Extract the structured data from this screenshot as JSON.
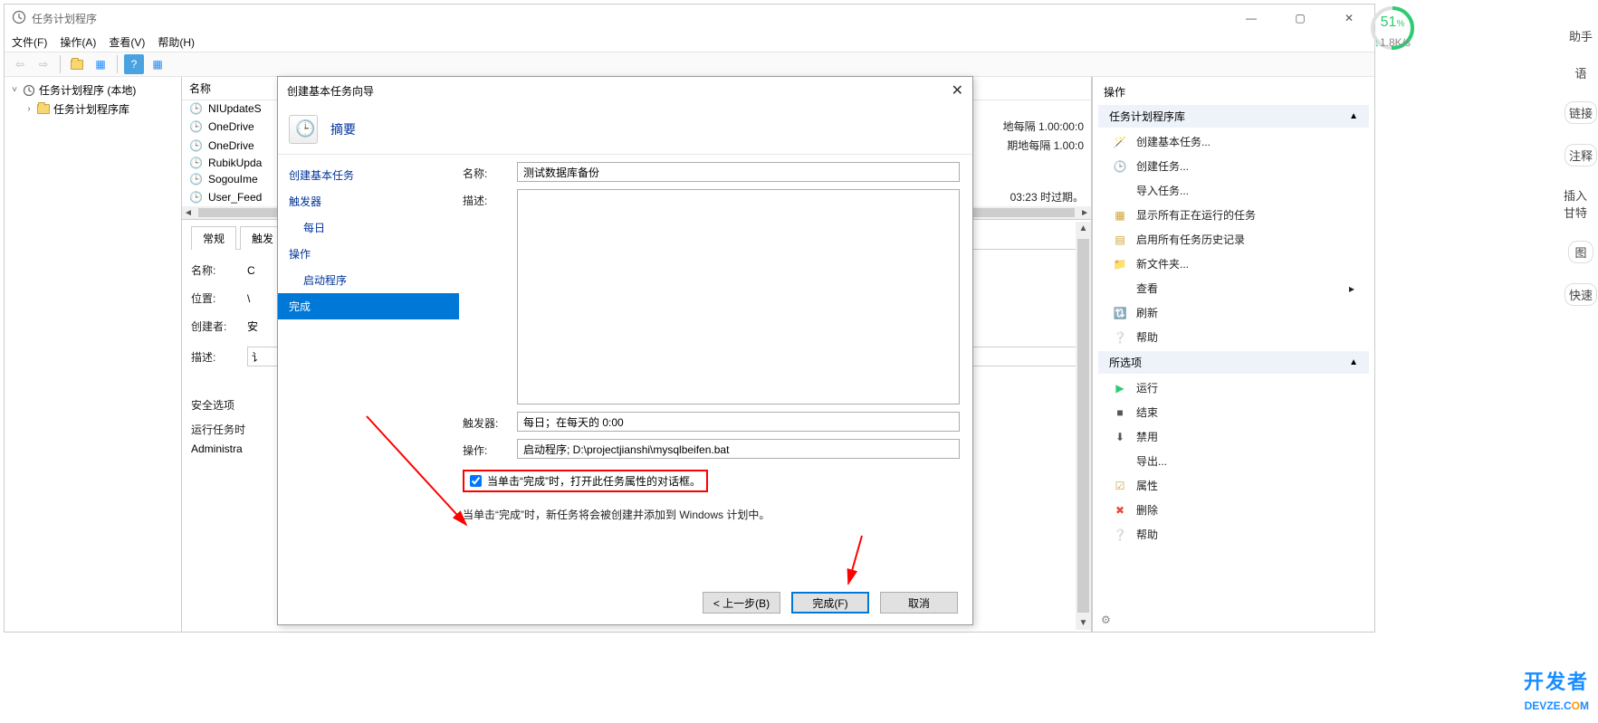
{
  "window": {
    "title": "任务计划程序",
    "menus": [
      "文件(F)",
      "操作(A)",
      "查看(V)",
      "帮助(H)"
    ]
  },
  "tree": {
    "root": "任务计划程序 (本地)",
    "child": "任务计划程序库"
  },
  "task_list": {
    "header": "名称",
    "rows": [
      {
        "name": "NIUpdateS",
        "trigger": ""
      },
      {
        "name": "OneDrive",
        "trigger": "地每隔 1.00:00:0"
      },
      {
        "name": "OneDrive",
        "trigger": "期地每隔 1.00:0"
      },
      {
        "name": "RubikUpda",
        "trigger": ""
      },
      {
        "name": "SogouIme",
        "trigger": ""
      },
      {
        "name": "User_Feed",
        "trigger": "03:23 时过期。"
      }
    ]
  },
  "detail": {
    "tabs": [
      "常规",
      "触发"
    ],
    "fields": {
      "name_label": "名称:",
      "name_val": "C",
      "location_label": "位置:",
      "location_val": "\\",
      "creator_label": "创建者:",
      "creator_val": "安",
      "desc_label": "描述:",
      "desc_val": "讠"
    },
    "security_title": "安全选项",
    "run_as_label": "运行任务时",
    "run_as_val": "Administra"
  },
  "actions_pane": {
    "title": "操作",
    "group1": {
      "title": "任务计划程序库",
      "items": [
        {
          "icon": "wizard",
          "label": "创建基本任务..."
        },
        {
          "icon": "clock",
          "label": "创建任务..."
        },
        {
          "icon": "import",
          "label": "导入任务..."
        },
        {
          "icon": "running",
          "label": "显示所有正在运行的任务"
        },
        {
          "icon": "history",
          "label": "启用所有任务历史记录"
        },
        {
          "icon": "folder",
          "label": "新文件夹..."
        },
        {
          "icon": "view",
          "label": "查看",
          "has_sub": true
        },
        {
          "icon": "refresh",
          "label": "刷新"
        },
        {
          "icon": "help",
          "label": "帮助"
        }
      ]
    },
    "group2": {
      "title": "所选项",
      "items": [
        {
          "icon": "play",
          "label": "运行"
        },
        {
          "icon": "stop",
          "label": "结束"
        },
        {
          "icon": "disable",
          "label": "禁用"
        },
        {
          "icon": "export",
          "label": "导出..."
        },
        {
          "icon": "props",
          "label": "属性"
        },
        {
          "icon": "delete",
          "label": "删除"
        },
        {
          "icon": "help",
          "label": "帮助"
        }
      ]
    }
  },
  "dialog": {
    "title": "创建基本任务向导",
    "banner": "摘要",
    "nav": [
      {
        "label": "创建基本任务",
        "sub": false
      },
      {
        "label": "触发器",
        "sub": false
      },
      {
        "label": "每日",
        "sub": true
      },
      {
        "label": "操作",
        "sub": false
      },
      {
        "label": "启动程序",
        "sub": true
      },
      {
        "label": "完成",
        "sub": false,
        "active": true
      }
    ],
    "fields": {
      "name_label": "名称:",
      "name_value": "测试数据库备份",
      "desc_label": "描述:",
      "desc_value": "",
      "trigger_label": "触发器:",
      "trigger_value": "每日；在每天的 0:00",
      "action_label": "操作:",
      "action_value": "启动程序; D:\\projectjianshi\\mysqlbeifen.bat"
    },
    "checkbox_label": "当单击“完成”时，打开此任务属性的对话框。",
    "info_text": "当单击“完成”时，新任务将会被创建并添加到 Windows 计划中。",
    "buttons": {
      "back": "< 上一步(B)",
      "finish": "完成(F)",
      "cancel": "取消"
    }
  },
  "perf": {
    "percent": "51",
    "unit": "%",
    "speed": "1.8K/s"
  },
  "far_right": [
    "助手",
    "语",
    "链接",
    "注释",
    "插入甘特",
    "图",
    "快速"
  ],
  "logo": {
    "zh": "开发者",
    "en_pre": "DEVZE.C",
    "en_o": "O",
    "en_post": "M"
  }
}
